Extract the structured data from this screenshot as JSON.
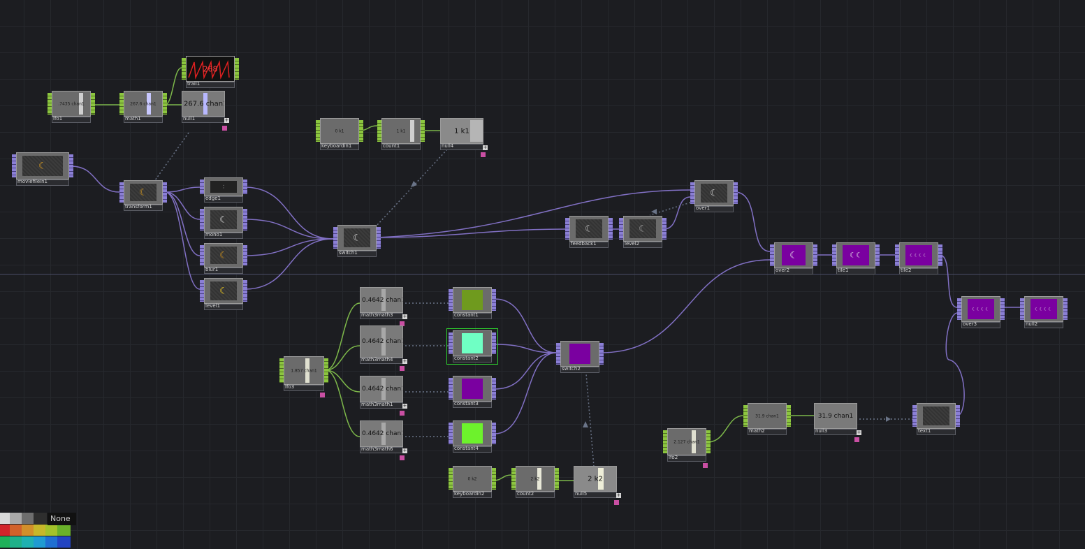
{
  "nodes": {
    "lfo1": {
      "name": "lfo1",
      "value": ".7435 chan1"
    },
    "math1": {
      "name": "math1",
      "value": "267.6 chan1"
    },
    "trail1": {
      "name": "trail1",
      "value": "268"
    },
    "null1": {
      "name": "null1",
      "value": "267.6 chan1"
    },
    "keyboardin1": {
      "name": "keyboardin1",
      "value": "0 k1"
    },
    "count1": {
      "name": "count1",
      "value": "1 k1"
    },
    "null4": {
      "name": "null4",
      "value": "1 k1"
    },
    "moviefilein1": {
      "name": "moviefilein1"
    },
    "transform1": {
      "name": "transform1"
    },
    "edge1": {
      "name": "edge1"
    },
    "mono1": {
      "name": "mono1"
    },
    "blur1": {
      "name": "blur1"
    },
    "level1": {
      "name": "level1"
    },
    "switch1": {
      "name": "switch1"
    },
    "feedback1": {
      "name": "feedback1"
    },
    "level2": {
      "name": "level2"
    },
    "over1": {
      "name": "over1"
    },
    "over2": {
      "name": "over2"
    },
    "tile1": {
      "name": "tile1"
    },
    "tile2": {
      "name": "tile2"
    },
    "over3": {
      "name": "over3"
    },
    "null2": {
      "name": "null2"
    },
    "math3math3": {
      "name": "math3math3",
      "value": "0.4642 chan1"
    },
    "math3math4": {
      "name": "math3math4",
      "value": "0.4642 chan1"
    },
    "math3math1": {
      "name": "math3math1",
      "value": "0.4642 chan1"
    },
    "math3math6": {
      "name": "math3math6",
      "value": "0.4642 chan1"
    },
    "lfo3": {
      "name": "lfo3",
      "value": "1.857 chan1"
    },
    "constant1": {
      "name": "constant1"
    },
    "constant2": {
      "name": "constant2"
    },
    "constant3": {
      "name": "constant3"
    },
    "constant4": {
      "name": "constant4"
    },
    "switch2": {
      "name": "switch2"
    },
    "keyboardin2": {
      "name": "keyboardin2",
      "value": "0 k2"
    },
    "count2": {
      "name": "count2",
      "value": "2 k2"
    },
    "null5": {
      "name": "null5",
      "value": "2 k2"
    },
    "lfo2": {
      "name": "lfo2",
      "value": "2.127 chan1"
    },
    "math2": {
      "name": "math2",
      "value": "31.9 chan1"
    },
    "null3": {
      "name": "null3",
      "value": "31.9 chan1"
    },
    "text1": {
      "name": "text1"
    }
  },
  "colors": {
    "chop": "#8cc63f",
    "top": "#8b7fd6",
    "constant1": "#6f9a1e",
    "constant2": "#6fffc4",
    "constant3": "#7a00a0",
    "constant4": "#6df22c",
    "purple_out": "#7a00a0"
  },
  "palette": {
    "none_label": "None",
    "row1": [
      "#d9d9d9",
      "#a9a9a9",
      "#6e6e6e",
      "#2e2e2e"
    ],
    "row2": [
      "#d2242a",
      "#d2612a",
      "#d28f2a",
      "#c7b72a",
      "#a3c22a",
      "#6ab12a"
    ],
    "row3": [
      "#1fb15a",
      "#1fb18a",
      "#1fb1b1",
      "#1f9bd2",
      "#1f6fd2",
      "#2244c2"
    ]
  }
}
